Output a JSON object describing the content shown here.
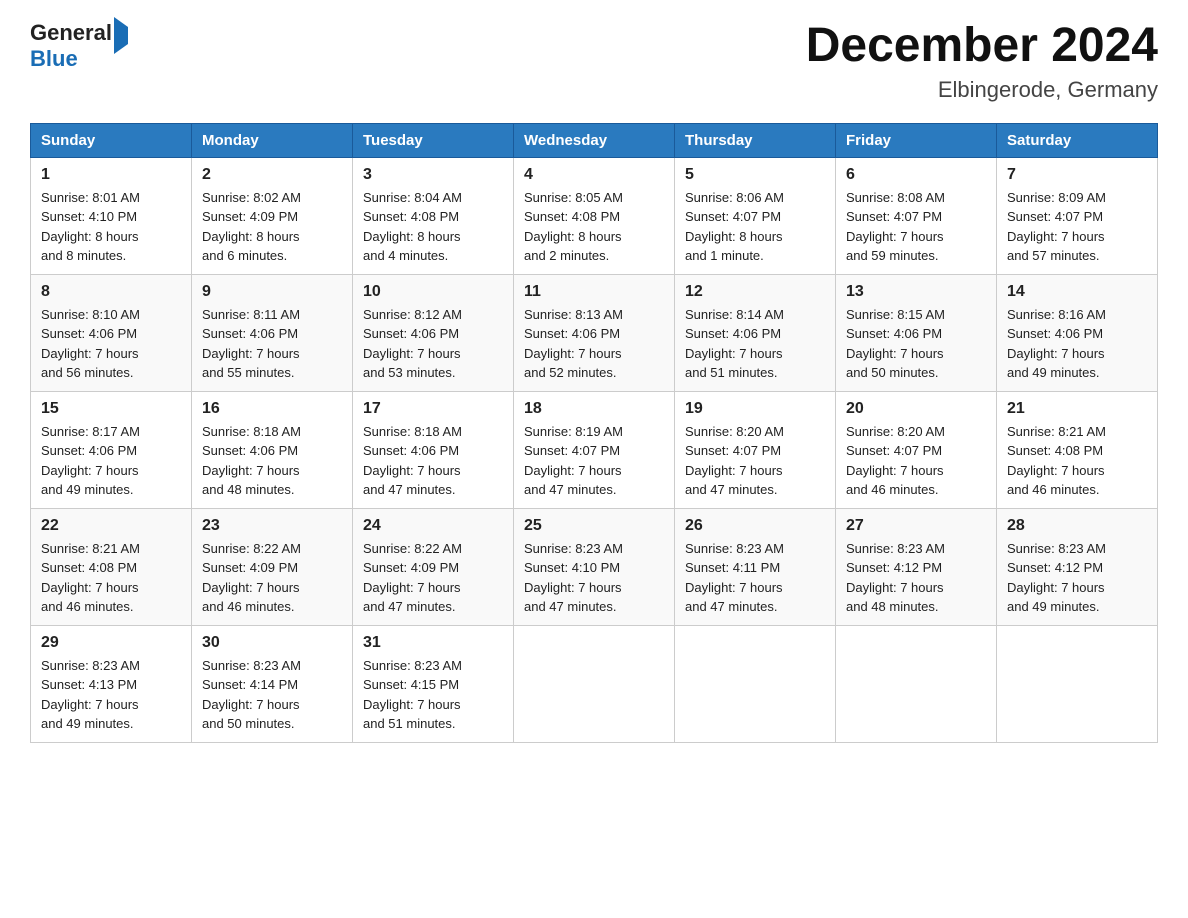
{
  "header": {
    "logo": {
      "general": "General",
      "blue": "Blue"
    },
    "title": "December 2024",
    "location": "Elbingerode, Germany"
  },
  "weekdays": [
    "Sunday",
    "Monday",
    "Tuesday",
    "Wednesday",
    "Thursday",
    "Friday",
    "Saturday"
  ],
  "weeks": [
    [
      {
        "day": "1",
        "sunrise": "8:01 AM",
        "sunset": "4:10 PM",
        "daylight": "8 hours and 8 minutes."
      },
      {
        "day": "2",
        "sunrise": "8:02 AM",
        "sunset": "4:09 PM",
        "daylight": "8 hours and 6 minutes."
      },
      {
        "day": "3",
        "sunrise": "8:04 AM",
        "sunset": "4:08 PM",
        "daylight": "8 hours and 4 minutes."
      },
      {
        "day": "4",
        "sunrise": "8:05 AM",
        "sunset": "4:08 PM",
        "daylight": "8 hours and 2 minutes."
      },
      {
        "day": "5",
        "sunrise": "8:06 AM",
        "sunset": "4:07 PM",
        "daylight": "8 hours and 1 minute."
      },
      {
        "day": "6",
        "sunrise": "8:08 AM",
        "sunset": "4:07 PM",
        "daylight": "7 hours and 59 minutes."
      },
      {
        "day": "7",
        "sunrise": "8:09 AM",
        "sunset": "4:07 PM",
        "daylight": "7 hours and 57 minutes."
      }
    ],
    [
      {
        "day": "8",
        "sunrise": "8:10 AM",
        "sunset": "4:06 PM",
        "daylight": "7 hours and 56 minutes."
      },
      {
        "day": "9",
        "sunrise": "8:11 AM",
        "sunset": "4:06 PM",
        "daylight": "7 hours and 55 minutes."
      },
      {
        "day": "10",
        "sunrise": "8:12 AM",
        "sunset": "4:06 PM",
        "daylight": "7 hours and 53 minutes."
      },
      {
        "day": "11",
        "sunrise": "8:13 AM",
        "sunset": "4:06 PM",
        "daylight": "7 hours and 52 minutes."
      },
      {
        "day": "12",
        "sunrise": "8:14 AM",
        "sunset": "4:06 PM",
        "daylight": "7 hours and 51 minutes."
      },
      {
        "day": "13",
        "sunrise": "8:15 AM",
        "sunset": "4:06 PM",
        "daylight": "7 hours and 50 minutes."
      },
      {
        "day": "14",
        "sunrise": "8:16 AM",
        "sunset": "4:06 PM",
        "daylight": "7 hours and 49 minutes."
      }
    ],
    [
      {
        "day": "15",
        "sunrise": "8:17 AM",
        "sunset": "4:06 PM",
        "daylight": "7 hours and 49 minutes."
      },
      {
        "day": "16",
        "sunrise": "8:18 AM",
        "sunset": "4:06 PM",
        "daylight": "7 hours and 48 minutes."
      },
      {
        "day": "17",
        "sunrise": "8:18 AM",
        "sunset": "4:06 PM",
        "daylight": "7 hours and 47 minutes."
      },
      {
        "day": "18",
        "sunrise": "8:19 AM",
        "sunset": "4:07 PM",
        "daylight": "7 hours and 47 minutes."
      },
      {
        "day": "19",
        "sunrise": "8:20 AM",
        "sunset": "4:07 PM",
        "daylight": "7 hours and 47 minutes."
      },
      {
        "day": "20",
        "sunrise": "8:20 AM",
        "sunset": "4:07 PM",
        "daylight": "7 hours and 46 minutes."
      },
      {
        "day": "21",
        "sunrise": "8:21 AM",
        "sunset": "4:08 PM",
        "daylight": "7 hours and 46 minutes."
      }
    ],
    [
      {
        "day": "22",
        "sunrise": "8:21 AM",
        "sunset": "4:08 PM",
        "daylight": "7 hours and 46 minutes."
      },
      {
        "day": "23",
        "sunrise": "8:22 AM",
        "sunset": "4:09 PM",
        "daylight": "7 hours and 46 minutes."
      },
      {
        "day": "24",
        "sunrise": "8:22 AM",
        "sunset": "4:09 PM",
        "daylight": "7 hours and 47 minutes."
      },
      {
        "day": "25",
        "sunrise": "8:23 AM",
        "sunset": "4:10 PM",
        "daylight": "7 hours and 47 minutes."
      },
      {
        "day": "26",
        "sunrise": "8:23 AM",
        "sunset": "4:11 PM",
        "daylight": "7 hours and 47 minutes."
      },
      {
        "day": "27",
        "sunrise": "8:23 AM",
        "sunset": "4:12 PM",
        "daylight": "7 hours and 48 minutes."
      },
      {
        "day": "28",
        "sunrise": "8:23 AM",
        "sunset": "4:12 PM",
        "daylight": "7 hours and 49 minutes."
      }
    ],
    [
      {
        "day": "29",
        "sunrise": "8:23 AM",
        "sunset": "4:13 PM",
        "daylight": "7 hours and 49 minutes."
      },
      {
        "day": "30",
        "sunrise": "8:23 AM",
        "sunset": "4:14 PM",
        "daylight": "7 hours and 50 minutes."
      },
      {
        "day": "31",
        "sunrise": "8:23 AM",
        "sunset": "4:15 PM",
        "daylight": "7 hours and 51 minutes."
      },
      null,
      null,
      null,
      null
    ]
  ],
  "labels": {
    "sunrise": "Sunrise:",
    "sunset": "Sunset:",
    "daylight": "Daylight:"
  }
}
